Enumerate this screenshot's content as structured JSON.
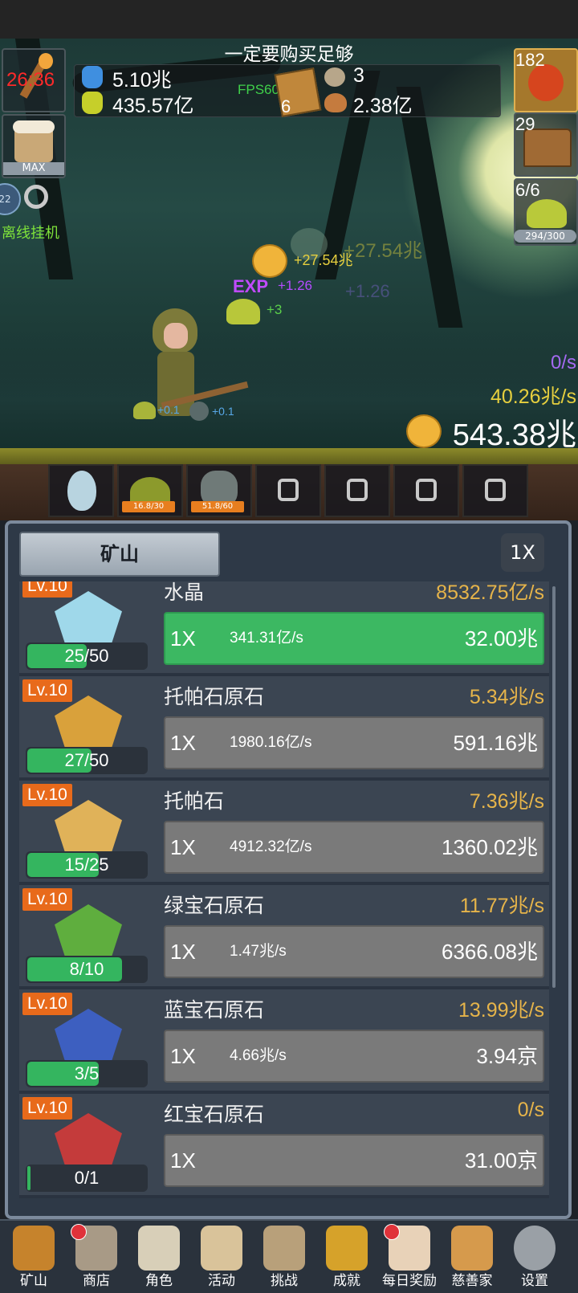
{
  "hud": {
    "title": "一定要购买足够",
    "timer": "26:36",
    "potion_blue": "5.10兆",
    "potion_yellow": "435.57亿",
    "fps": "FPS60",
    "book_count": "6",
    "stone_count": "3",
    "meat_count": "2.38亿",
    "potion_red_count": "182",
    "chest_count": "29",
    "slime_count": "6/6",
    "slime_progress": "294/300",
    "max_label": "MAX",
    "offline_label": "离线挂机",
    "offline_badge": "22"
  },
  "scene": {
    "float_gold": "+27.54兆",
    "float_gold_ghost": "+27.54兆",
    "float_exp_label": "EXP",
    "float_exp": "+1.26",
    "float_exp_ghost": "+1.26",
    "float_slime": "+3",
    "drop1": "+0.1",
    "drop2": "+0.1",
    "rate_purple": "0/s",
    "rate_gold": "40.26兆/s",
    "gold_total": "543.38兆"
  },
  "slots": [
    {
      "label": ""
    },
    {
      "label": "16.8/30"
    },
    {
      "label": "51.8/60"
    }
  ],
  "panel": {
    "tab_label": "矿山",
    "speed_label": "1X"
  },
  "mines": [
    {
      "lv": "Lv.10",
      "name": "水晶",
      "rate": "8532.75亿/s",
      "progress": "25/50",
      "fill": 0.5,
      "mult": "1X",
      "gain": "341.31亿/s",
      "cost": "32.00兆",
      "affordable": true,
      "color": "#9fd8ea"
    },
    {
      "lv": "Lv.10",
      "name": "托帕石原石",
      "rate": "5.34兆/s",
      "progress": "27/50",
      "fill": 0.54,
      "mult": "1X",
      "gain": "1980.16亿/s",
      "cost": "591.16兆",
      "affordable": false,
      "color": "#d9a13b"
    },
    {
      "lv": "Lv.10",
      "name": "托帕石",
      "rate": "7.36兆/s",
      "progress": "15/25",
      "fill": 0.6,
      "mult": "1X",
      "gain": "4912.32亿/s",
      "cost": "1360.02兆",
      "affordable": false,
      "color": "#e0b259"
    },
    {
      "lv": "Lv.10",
      "name": "绿宝石原石",
      "rate": "11.77兆/s",
      "progress": "8/10",
      "fill": 0.8,
      "mult": "1X",
      "gain": "1.47兆/s",
      "cost": "6366.08兆",
      "affordable": false,
      "color": "#5fae3e"
    },
    {
      "lv": "Lv.10",
      "name": "蓝宝石原石",
      "rate": "13.99兆/s",
      "progress": "3/5",
      "fill": 0.6,
      "mult": "1X",
      "gain": "4.66兆/s",
      "cost": "3.94京",
      "affordable": false,
      "color": "#3d5fc0"
    },
    {
      "lv": "Lv.10",
      "name": "红宝石原石",
      "rate": "0/s",
      "progress": "0/1",
      "fill": 0.02,
      "mult": "1X",
      "gain": "",
      "cost": "31.00京",
      "affordable": false,
      "color": "#c43b3b"
    }
  ],
  "nav": [
    {
      "label": "矿山",
      "icon": "lantern-icon",
      "dot": false
    },
    {
      "label": "商店",
      "icon": "shop-stone-icon",
      "dot": true
    },
    {
      "label": "角色",
      "icon": "skull-icon",
      "dot": false
    },
    {
      "label": "活动",
      "icon": "scroll-icon",
      "dot": false
    },
    {
      "label": "挑战",
      "icon": "map-icon",
      "dot": false
    },
    {
      "label": "成就",
      "icon": "key-icon",
      "dot": false
    },
    {
      "label": "每日奖励",
      "icon": "envelope-icon",
      "dot": true
    },
    {
      "label": "慈善家",
      "icon": "bread-icon",
      "dot": false
    },
    {
      "label": "设置",
      "icon": "gear-icon",
      "dot": false
    }
  ]
}
